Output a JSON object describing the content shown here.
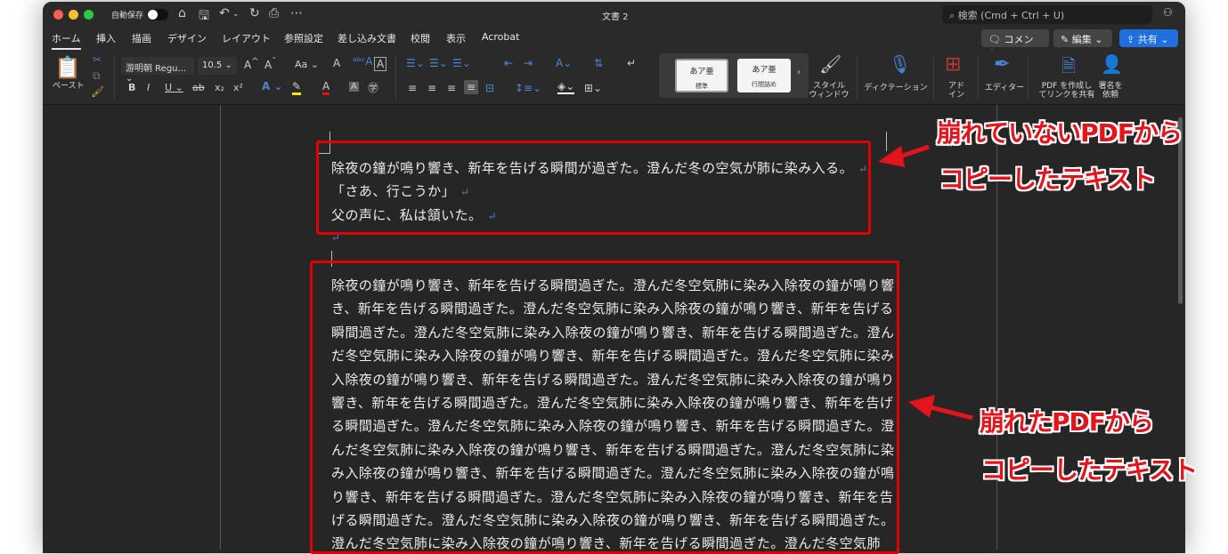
{
  "window": {
    "title": "文書 2",
    "autosave_label": "自動保存",
    "search_placeholder": "検索 (Cmd + Ctrl + U)"
  },
  "tabs": [
    "ホーム",
    "挿入",
    "描画",
    "デザイン",
    "レイアウト",
    "参照設定",
    "差し込み文書",
    "校閲",
    "表示",
    "Acrobat"
  ],
  "actions": {
    "comment": "コメント",
    "edit": "編集",
    "share": "共有"
  },
  "ribbon": {
    "paste": "ペースト",
    "font_name": "游明朝 Regu...",
    "font_size": "10.5",
    "case": "Aa",
    "style1": "あア亜",
    "style1_label": "標準",
    "style2": "あア亜",
    "style2_label": "行間詰め",
    "style_window_1": "スタイル",
    "style_window_2": "ウィンドウ",
    "dictation": "ディクテーション",
    "addin_1": "アド",
    "addin_2": "イン",
    "editor": "エディター",
    "pdf_1": "PDF を作成し",
    "pdf_2": "てリンクを共有",
    "sign_1": "署名を",
    "sign_2": "依頼"
  },
  "document": {
    "block1": [
      "除夜の鐘が鳴り響き、新年を告げる瞬間が過ぎた。澄んだ冬の空気が肺に染み入る。",
      "「さあ、行こうか」",
      "父の声に、私は頷いた。"
    ],
    "block2": [
      "除夜の鐘が鳴り響き、新年を告げる瞬間過ぎた。澄んだ冬空気肺に染み入除夜の鐘が鳴り響",
      "き、新年を告げる瞬間過ぎた。澄んだ冬空気肺に染み入除夜の鐘が鳴り響き、新年を告げる",
      "瞬間過ぎた。澄んだ冬空気肺に染み入除夜の鐘が鳴り響き、新年を告げる瞬間過ぎた。澄ん",
      "だ冬空気肺に染み入除夜の鐘が鳴り響き、新年を告げる瞬間過ぎた。澄んだ冬空気肺に染み",
      "入除夜の鐘が鳴り響き、新年を告げる瞬間過ぎた。澄んだ冬空気肺に染み入除夜の鐘が鳴り",
      "響き、新年を告げる瞬間過ぎた。澄んだ冬空気肺に染み入除夜の鐘が鳴り響き、新年を告げ",
      "る瞬間過ぎた。澄んだ冬空気肺に染み入除夜の鐘が鳴り響き、新年を告げる瞬間過ぎた。澄",
      "んだ冬空気肺に染み入除夜の鐘が鳴り響き、新年を告げる瞬間過ぎた。澄んだ冬空気肺に染",
      "み入除夜の鐘が鳴り響き、新年を告げる瞬間過ぎた。澄んだ冬空気肺に染み入除夜の鐘が鳴",
      "り響き、新年を告げる瞬間過ぎた。澄んだ冬空気肺に染み入除夜の鐘が鳴り響き、新年を告",
      "げる瞬間過ぎた。澄んだ冬空気肺に染み入除夜の鐘が鳴り響き、新年を告げる瞬間過ぎた。",
      "澄んだ冬空気肺に染み入除夜の鐘が鳴り響き、新年を告げる瞬間過ぎた。澄んだ冬空気肺"
    ]
  },
  "annotations": {
    "top_1": "崩れていないPDFから",
    "top_2": "コピーしたテキスト",
    "bottom_1": "崩れたPDFから",
    "bottom_2": "コピーしたテキスト"
  },
  "colors": {
    "annotation": "#e3141b",
    "share": "#1f6fe0",
    "background": "#262626"
  }
}
